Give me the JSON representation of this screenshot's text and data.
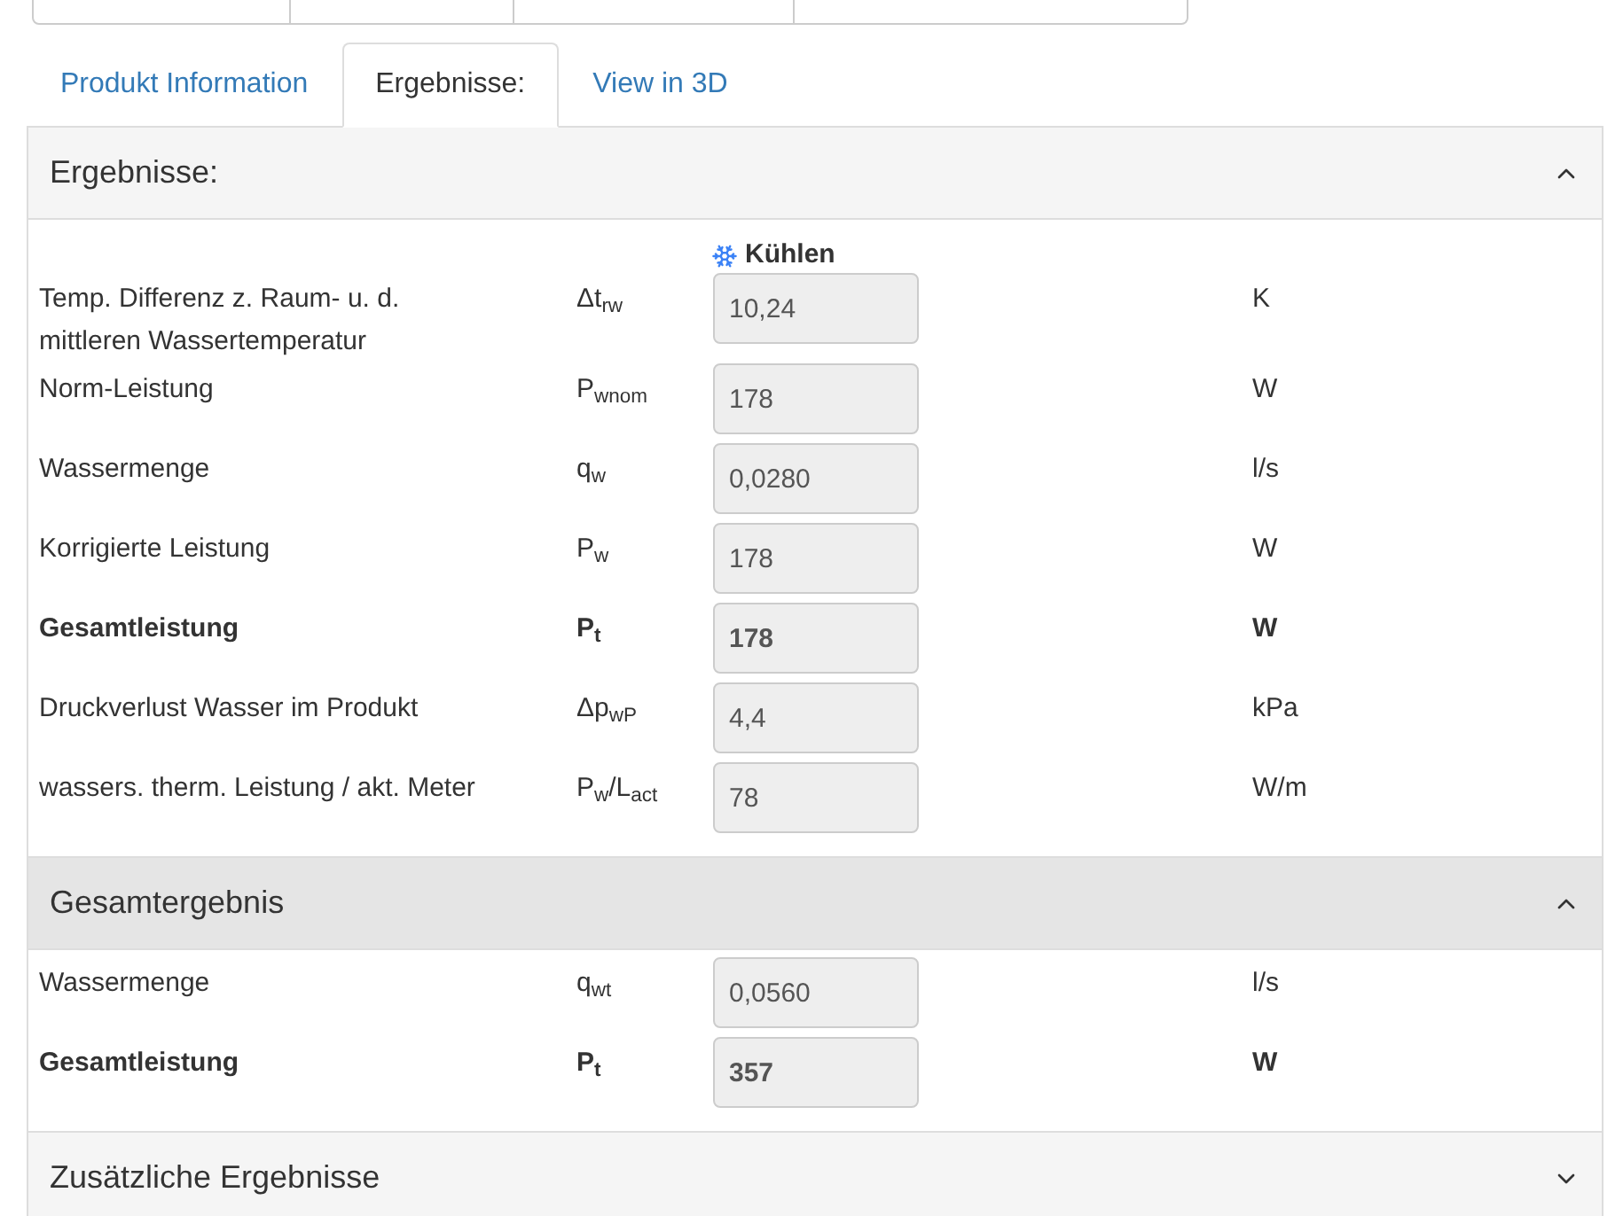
{
  "tabs": [
    {
      "label": "Produkt Information",
      "selected": false
    },
    {
      "label": "Ergebnisse:",
      "selected": true
    },
    {
      "label": "View in 3D",
      "selected": false
    }
  ],
  "sections": [
    {
      "title": "Ergebnisse:",
      "expanded": true,
      "shaded": false,
      "mode_label": "Kühlen",
      "rows": [
        {
          "label": "Temp. Differenz z. Raum- u. d. mittleren Wassertemperatur",
          "symbol": "Δt$_{rw}$",
          "value": "10,24",
          "unit": "K",
          "bold": false
        },
        {
          "label": "Norm-Leistung",
          "symbol": "P$_{wnom}$",
          "value": "178",
          "unit": "W",
          "bold": false
        },
        {
          "label": "Wassermenge",
          "symbol": "q$_{w}$",
          "value": "0,0280",
          "unit": "l/s",
          "bold": false
        },
        {
          "label": "Korrigierte Leistung",
          "symbol": "P$_{w}$",
          "value": "178",
          "unit": "W",
          "bold": false
        },
        {
          "label": "Gesamtleistung",
          "symbol": "P$_{t}$",
          "value": "178",
          "unit": "W",
          "bold": true
        },
        {
          "label": "Druckverlust Wasser im Produkt",
          "symbol": "Δp$_{wP}$",
          "value": "4,4",
          "unit": "kPa",
          "bold": false
        },
        {
          "label": "wassers. therm. Leistung / akt. Meter",
          "symbol": "P$_{w}$/L$_{act}$",
          "value": "78",
          "unit": "W/m",
          "bold": false
        }
      ]
    },
    {
      "title": "Gesamtergebnis",
      "expanded": true,
      "shaded": true,
      "rows": [
        {
          "label": "Wassermenge",
          "symbol": "q$_{wt}$",
          "value": "0,0560",
          "unit": "l/s",
          "bold": false
        },
        {
          "label": "Gesamtleistung",
          "symbol": "P$_{t}$",
          "value": "357",
          "unit": "W",
          "bold": true
        }
      ]
    },
    {
      "title": "Zusätzliche Ergebnisse",
      "expanded": false,
      "shaded": false
    }
  ]
}
